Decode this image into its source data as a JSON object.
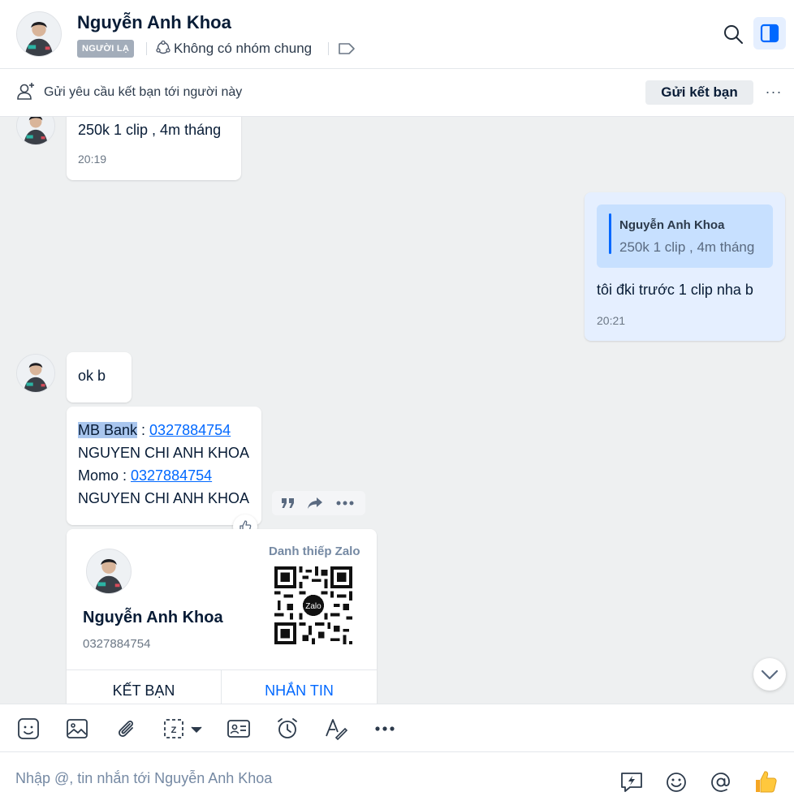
{
  "header": {
    "name": "Nguyễn Anh Khoa",
    "badge": "NGƯỜI LẠ",
    "group_status": "Không có nhóm chung"
  },
  "friend_bar": {
    "text": "Gửi yêu cầu kết bạn tới người này",
    "button": "Gửi kết bạn",
    "more": "···"
  },
  "messages": [
    {
      "text": "250k 1 clip , 4m tháng",
      "time": "20:19"
    },
    {
      "quote_author": "Nguyễn Anh Khoa",
      "quote_text": "250k 1 clip , 4m tháng",
      "text": "tôi đki trước 1 clip nha b",
      "time": "20:21"
    },
    {
      "text": "ok b"
    },
    {
      "bank_label": "MB Bank",
      "sep1": " : ",
      "bank_number": "0327884754",
      "line2": "NGUYEN CHI ANH KHOA",
      "momo_label": "Momo : ",
      "momo_number": "0327884754",
      "line4": "NGUYEN CHI ANH KHOA"
    }
  ],
  "contact_card": {
    "label": "Danh thiếp Zalo",
    "name": "Nguyễn Anh Khoa",
    "phone": "0327884754",
    "qr_logo": "Zalo",
    "add_friend": "KẾT BẠN",
    "message": "NHẮN TIN"
  },
  "composer": {
    "placeholder": "Nhập @, tin nhắn tới Nguyễn Anh Khoa"
  },
  "colors": {
    "accent": "#0068ff",
    "sent_bubble": "#e5efff",
    "quote_bg": "#c7e0ff",
    "chat_bg": "#eef0f1",
    "badge_bg": "#a3adba"
  }
}
